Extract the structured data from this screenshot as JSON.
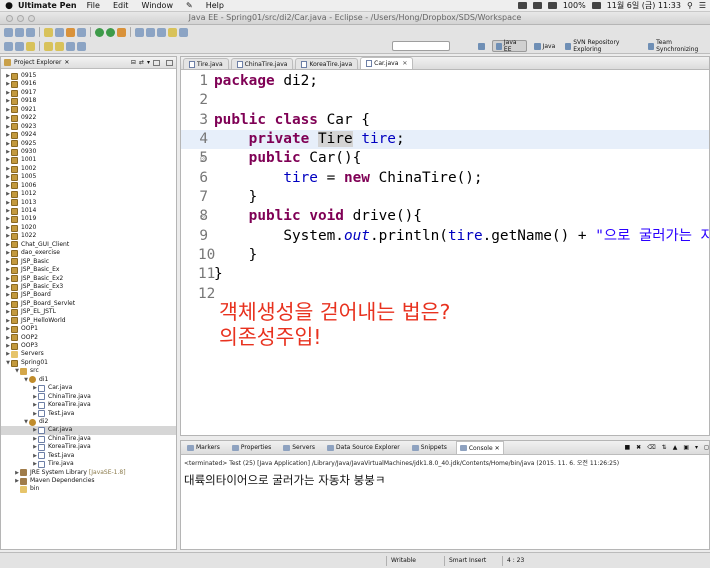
{
  "menubar": {
    "app_name": "Ultimate Pen",
    "items": [
      "File",
      "Edit",
      "Window",
      "Help"
    ],
    "battery": "100%",
    "clock": "11월 6일 (금)  11:33"
  },
  "window": {
    "title": "Java EE - Spring01/src/di2/Car.java - Eclipse - /Users/Hong/Dropbox/SDS/Workspace"
  },
  "perspectives": [
    {
      "label": "Java EE"
    },
    {
      "label": "Java"
    },
    {
      "label": "SVN Repository Exploring"
    },
    {
      "label": "Team Synchronizing"
    }
  ],
  "explorer": {
    "title": "Project Explorer",
    "rows": [
      {
        "label": "0915",
        "extra": ""
      },
      {
        "label": "0916",
        "extra": ""
      },
      {
        "label": "0917",
        "extra": ""
      },
      {
        "label": "0918",
        "extra": ""
      },
      {
        "label": "0921",
        "extra": ""
      },
      {
        "label": "0922",
        "extra": ""
      },
      {
        "label": "0923",
        "extra": ""
      },
      {
        "label": "0924",
        "extra": ""
      },
      {
        "label": "0925",
        "extra": ""
      },
      {
        "label": "0930",
        "extra": ""
      },
      {
        "label": "1001",
        "extra": ""
      },
      {
        "label": "1002",
        "extra": ""
      },
      {
        "label": "1005",
        "extra": ""
      },
      {
        "label": "1006",
        "extra": ""
      },
      {
        "label": "1012",
        "extra": ""
      },
      {
        "label": "1013",
        "extra": ""
      },
      {
        "label": "1014",
        "extra": ""
      },
      {
        "label": "1019",
        "extra": ""
      },
      {
        "label": "1020",
        "extra": ""
      },
      {
        "label": "1022",
        "extra": ""
      },
      {
        "label": "Chat_GUI_Client",
        "extra": ""
      },
      {
        "label": "dao_exercise",
        "extra": ""
      },
      {
        "label": "JSP_Basic",
        "extra": ""
      },
      {
        "label": "JSP_Basic_Ex",
        "extra": ""
      },
      {
        "label": "JSP_Basic_Ex2",
        "extra": ""
      },
      {
        "label": "JSP_Basic_Ex3",
        "extra": ""
      },
      {
        "label": "JSP_Board",
        "extra": ""
      },
      {
        "label": "JSP_Board_Servlet",
        "extra": ""
      },
      {
        "label": "JSP_EL_JSTL",
        "extra": ""
      },
      {
        "label": "JSP_HelloWorld",
        "extra": ""
      },
      {
        "label": "OOP1",
        "extra": ""
      },
      {
        "label": "OOP2",
        "extra": ""
      },
      {
        "label": "OOP3",
        "extra": ""
      },
      {
        "label": "Servers",
        "extra": ""
      },
      {
        "label": "Spring01",
        "extra": ""
      },
      {
        "label": "src",
        "extra": ""
      },
      {
        "label": "di1",
        "extra": ""
      },
      {
        "label": "Car.java",
        "extra": ""
      },
      {
        "label": "ChinaTire.java",
        "extra": ""
      },
      {
        "label": "KoreaTire.java",
        "extra": ""
      },
      {
        "label": "Test.java",
        "extra": ""
      },
      {
        "label": "di2",
        "extra": ""
      },
      {
        "label": "Car.java",
        "extra": ""
      },
      {
        "label": "ChinaTire.java",
        "extra": ""
      },
      {
        "label": "KoreaTire.java",
        "extra": ""
      },
      {
        "label": "Test.java",
        "extra": ""
      },
      {
        "label": "Tire.java",
        "extra": ""
      },
      {
        "label": "JRE System Library",
        "extra": "[JavaSE-1.8]"
      },
      {
        "label": "Maven Dependencies",
        "extra": ""
      },
      {
        "label": "bin",
        "extra": ""
      }
    ]
  },
  "editor": {
    "tabs": [
      "Tire.java",
      "ChinaTire.java",
      "KoreaTire.java",
      "Car.java"
    ],
    "line_numbers": [
      "1",
      "2",
      "3",
      "4",
      "5",
      "6",
      "7",
      "8",
      "9",
      "10",
      "11",
      "12"
    ],
    "code": {
      "l1_kw": "package",
      "l1_rest": " di2;",
      "l3_kw1": "public",
      "l3_kw2": "class",
      "l3_rest": " Car {",
      "l4_kw": "private",
      "l4_type": "Tire",
      "l4_field": "tire",
      "l4_end": ";",
      "l5_kw": "public",
      "l5_rest": " Car(){",
      "l6_field": "tire",
      "l6_mid": " = ",
      "l6_kw": "new",
      "l6_rest": " ChinaTire();",
      "l7": "}",
      "l8_kw1": "public",
      "l8_kw2": "void",
      "l8_rest": " drive(){",
      "l9_a": "System.",
      "l9_out": "out",
      "l9_b": ".println(",
      "l9_field": "tire",
      "l9_c": ".getName() + ",
      "l9_str": "\"으로 굴러가는 자",
      "l10": "}",
      "l11": "}"
    },
    "annotation_lines": [
      "객체생성을 걷어내는 법은?",
      "의존성주입!"
    ]
  },
  "bottom_panel": {
    "tabs": [
      "Markers",
      "Properties",
      "Servers",
      "Data Source Explorer",
      "Snippets",
      "Console"
    ],
    "console_header": "<terminated> Test (25) [Java Application] /Library/Java/JavaVirtualMachines/jdk1.8.0_40.jdk/Contents/Home/bin/java (2015. 11. 6. 오전 11:26:25)",
    "console_output": "대륙의타이어으로 굴러가는 자동차 붕붕ㅋ"
  },
  "status": {
    "writable": "Writable",
    "insert_mode": "Smart Insert",
    "position": "4 : 23"
  }
}
